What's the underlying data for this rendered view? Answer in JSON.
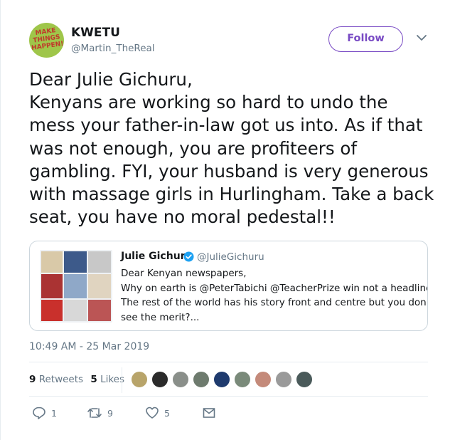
{
  "author": {
    "avatar_text": "MAKE THINGS HAPPEN!",
    "display_name": "KWETU",
    "handle": "@Martin_TheReal"
  },
  "follow_label": "Follow",
  "tweet_lines": [
    "Dear Julie Gichuru,",
    "Kenyans are working so hard to undo the",
    "mess your father-in-law got us into. As if that",
    "was not enough, you are profiteers of",
    "gambling. FYI, your husband is very generous",
    "with massage girls in Hurlingham. Take a back",
    "seat, you have no moral pedestal!!"
  ],
  "quoted": {
    "display_name": "Julie Gichuru",
    "handle": "@JulieGichuru",
    "body_lines": [
      "Dear Kenyan newspapers,",
      "Why on earth is @PeterTabichi @TeacherPrize win not a headline?",
      "The rest of the world has his story front and centre but you don't",
      "see the merit?..."
    ]
  },
  "timestamp": "10:49 AM - 25 Mar 2019",
  "stats": {
    "retweets_count": "9",
    "retweets_label": "Retweets",
    "likes_count": "5",
    "likes_label": "Likes"
  },
  "actions": {
    "reply_count": "1",
    "retweet_count": "9",
    "like_count": "5"
  },
  "colors": {
    "accent": "#794bc4",
    "secondary_text": "#657786",
    "verified": "#1da1f2",
    "divider": "#e6ecf0"
  },
  "icons": [
    "chevron-down-icon",
    "verified-badge-icon",
    "reply-icon",
    "retweet-icon",
    "heart-icon",
    "envelope-icon"
  ]
}
